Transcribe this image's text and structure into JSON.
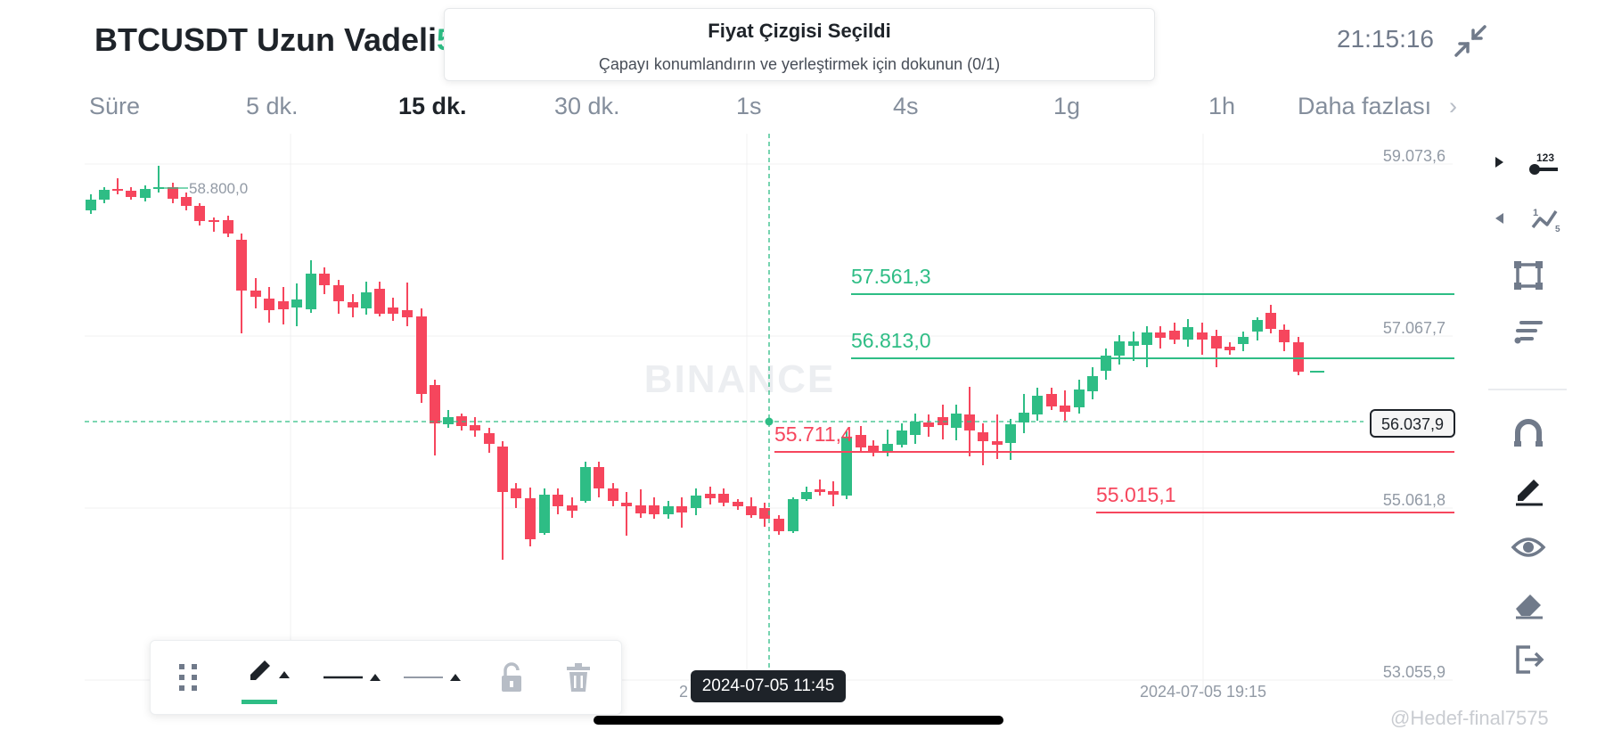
{
  "header": {
    "title": "BTCUSDT Uzun Vadeli",
    "title_extra": "5",
    "clock": "21:15:16"
  },
  "toast": {
    "title": "Fiyat Çizgisi Seçildi",
    "subtitle": "Çapayı konumlandırın ve yerleştirmek için dokunun (0/1)"
  },
  "timeframes": [
    {
      "label": "Süre",
      "active": false
    },
    {
      "label": "5 dk.",
      "active": false
    },
    {
      "label": "15 dk.",
      "active": true
    },
    {
      "label": "30 dk.",
      "active": false
    },
    {
      "label": "1s",
      "active": false
    },
    {
      "label": "4s",
      "active": false
    },
    {
      "label": "1g",
      "active": false
    },
    {
      "label": "1h",
      "active": false
    },
    {
      "label": "Daha fazlası",
      "active": false
    }
  ],
  "chart": {
    "watermark": "BINANCE",
    "price_axis": [
      "59.073,6",
      "57.067,7",
      "55.061,8",
      "53.055,9"
    ],
    "current_price": "56.037,9",
    "high_label": "58.800,0",
    "time_labels": [
      "2",
      "2024-07-05 19:15"
    ],
    "crosshair_time": "2024-07-05 11:45",
    "lines": [
      {
        "label": "57.561,3",
        "color": "#2ebd85"
      },
      {
        "label": "56.813,0",
        "color": "#2ebd85"
      },
      {
        "label": "55.711,4",
        "color": "#f6465d"
      },
      {
        "label": "55.015,1",
        "color": "#f6465d"
      }
    ],
    "colors": {
      "up": "#2ebd85",
      "down": "#f6465d",
      "grid": "#f0f1f2",
      "axis_text": "#929aa5"
    }
  },
  "sidebar": {
    "icons": [
      "price-label-icon",
      "fibonacci-icon",
      "rectangle-icon",
      "indicators-icon",
      "magnet-icon",
      "draw-icon",
      "eye-icon",
      "eraser-icon",
      "exit-icon"
    ],
    "price_label_text": "123",
    "fib_text": "5"
  },
  "toolbar": {
    "icons": [
      "drag-handle-icon",
      "pencil-color-icon",
      "line-width-icon",
      "line-style-icon",
      "lock-icon",
      "trash-icon"
    ]
  },
  "watermark": "@Hedef-final7575"
}
